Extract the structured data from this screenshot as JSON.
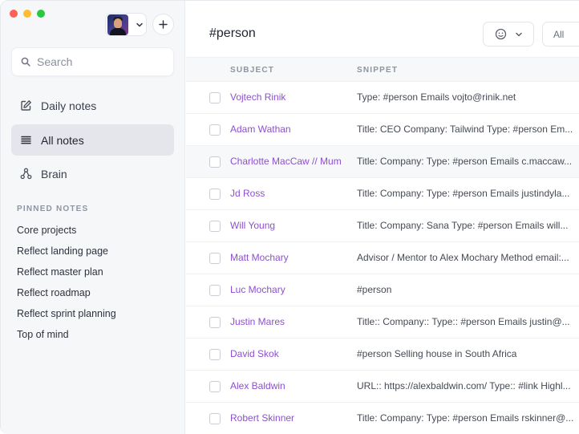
{
  "sidebar": {
    "search_placeholder": "Search",
    "nav": [
      {
        "label": "Daily notes",
        "icon": "edit-icon"
      },
      {
        "label": "All notes",
        "icon": "list-icon"
      },
      {
        "label": "Brain",
        "icon": "graph-icon"
      }
    ],
    "pinned_title": "PINNED NOTES",
    "pinned": [
      "Core projects",
      "Reflect landing page",
      "Reflect master plan",
      "Reflect roadmap",
      "Reflect sprint planning",
      "Top of mind"
    ]
  },
  "main": {
    "title": "#person",
    "filter_label": "All",
    "columns": {
      "subject": "SUBJECT",
      "snippet": "SNIPPET"
    },
    "rows": [
      {
        "subject": "Vojtech Rinik",
        "snippet": "Type: #person Emails vojto@rinik.net"
      },
      {
        "subject": "Adam Wathan",
        "snippet": "Title: CEO Company: Tailwind Type: #person Em..."
      },
      {
        "subject": "Charlotte MacCaw // Mum",
        "snippet": "Title: Company: Type: #person Emails c.maccaw..."
      },
      {
        "subject": "Jd Ross",
        "snippet": "Title: Company: Type: #person Emails justindyla..."
      },
      {
        "subject": "Will Young",
        "snippet": "Title: Company: Sana Type: #person Emails will..."
      },
      {
        "subject": "Matt Mochary",
        "snippet": "Advisor / Mentor to Alex Mochary Method email:..."
      },
      {
        "subject": "Luc Mochary",
        "snippet": "#person"
      },
      {
        "subject": "Justin Mares",
        "snippet": "Title:: Company:: Type:: #person Emails justin@..."
      },
      {
        "subject": "David Skok",
        "snippet": "#person Selling house in South Africa"
      },
      {
        "subject": "Alex Baldwin",
        "snippet": "URL:: https://alexbaldwin.com/ Type:: #link Highl..."
      },
      {
        "subject": "Robert Skinner",
        "snippet": "Title: Company: Type: #person Emails rskinner@..."
      }
    ]
  },
  "colors": {
    "accent": "#8d4fd0",
    "sidebar_bg": "#f6f7f9",
    "active_nav_bg": "#e4e6eb"
  }
}
